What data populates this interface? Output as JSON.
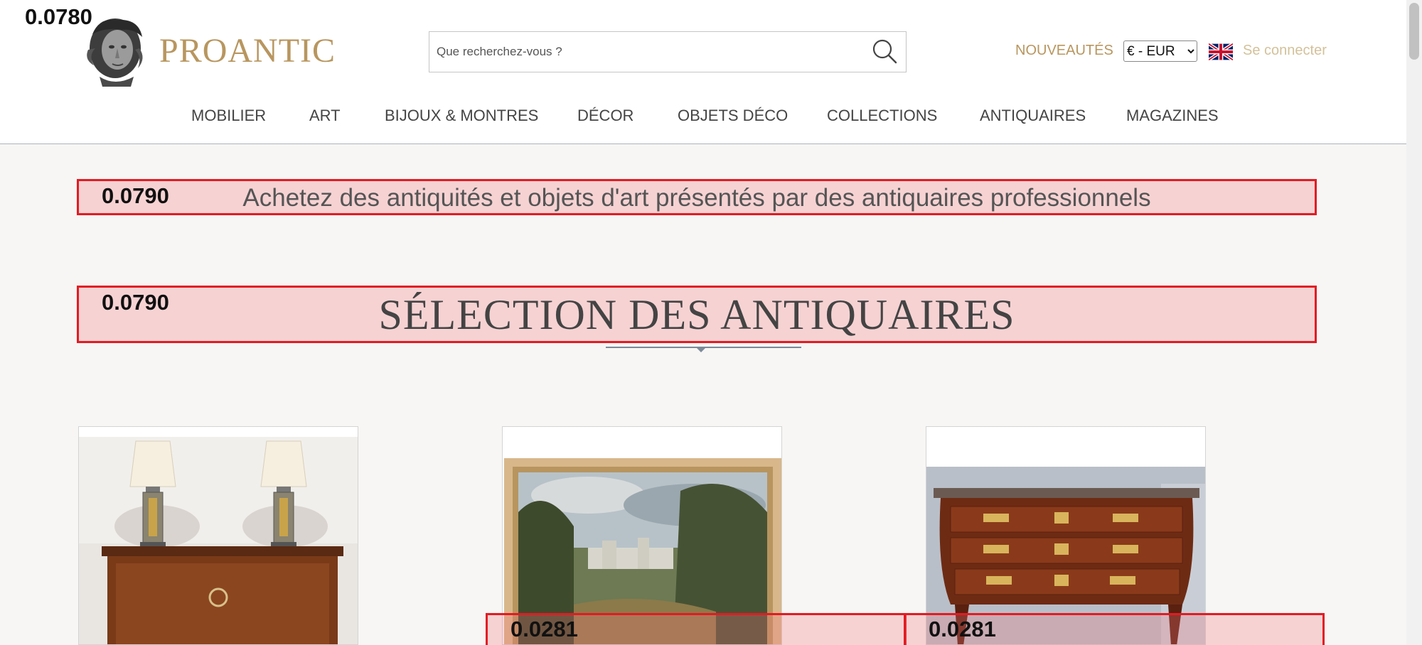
{
  "header": {
    "logo_text": "PROANTIC",
    "search": {
      "placeholder": "Que recherchez-vous ?"
    },
    "nouveautes_label": "NOUVEAUTÉS",
    "currency": {
      "selected": "€ - EUR"
    },
    "login_label": "Se connecter"
  },
  "nav": {
    "items": [
      {
        "label": "MOBILIER"
      },
      {
        "label": "ART"
      },
      {
        "label": "BIJOUX & MONTRES"
      },
      {
        "label": "DÉCOR"
      },
      {
        "label": "OBJETS DÉCO"
      },
      {
        "label": "COLLECTIONS"
      },
      {
        "label": "ANTIQUAIRES"
      },
      {
        "label": "MAGAZINES"
      }
    ]
  },
  "main": {
    "tagline": "Achetez des antiquités et objets d'art présentés par des antiquaires professionnels",
    "section_title": "SÉLECTION DES ANTIQUAIRES",
    "cards": [
      {
        "name": "art-deco-secretaire"
      },
      {
        "name": "landscape-painting"
      },
      {
        "name": "louis-xv-commode"
      }
    ]
  },
  "overlay_scores": {
    "logo": "0.0780",
    "tagline": "0.0790",
    "section_title": "0.0790",
    "card_2": "0.0281",
    "card_3": "0.0281"
  },
  "colors": {
    "gold": "#b8965f",
    "highlight_border": "#e31b23",
    "page_background": "#f7f6f4"
  },
  "icons": [
    "search-icon",
    "uk-flag-icon",
    "logo-bust"
  ]
}
